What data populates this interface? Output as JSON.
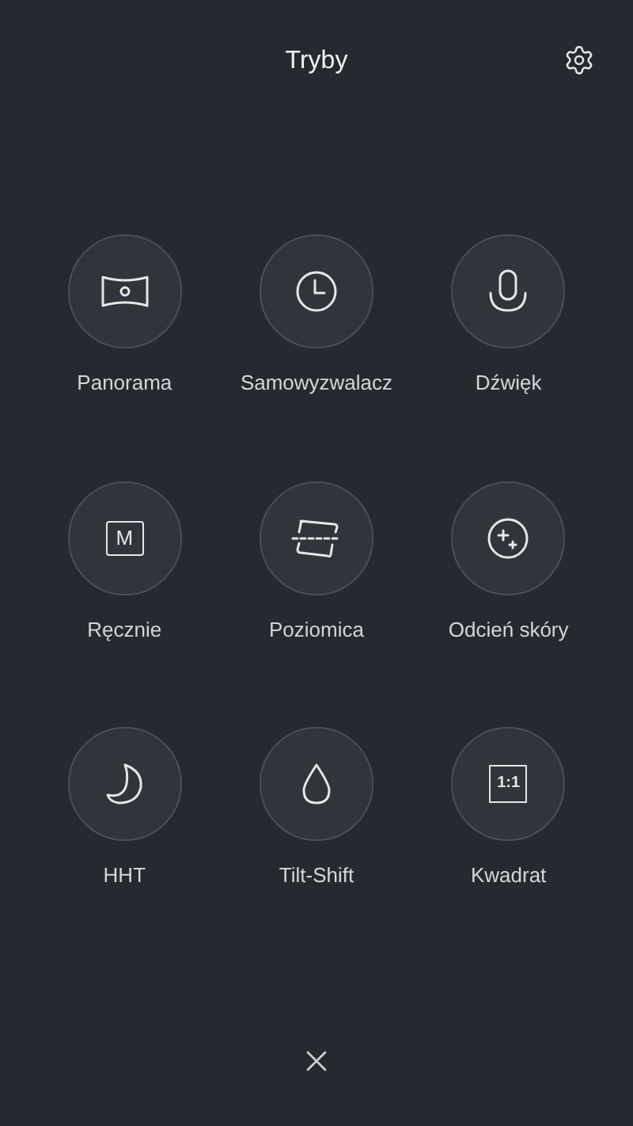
{
  "title": "Tryby",
  "modes": [
    {
      "kind": "panorama",
      "label": "Panorama"
    },
    {
      "kind": "timer",
      "label": "Samowyzwalacz"
    },
    {
      "kind": "audio",
      "label": "Dźwięk"
    },
    {
      "kind": "manual",
      "label": "Ręcznie",
      "icon_text": "M"
    },
    {
      "kind": "level",
      "label": "Poziomica"
    },
    {
      "kind": "beauty",
      "label": "Odcień skóry"
    },
    {
      "kind": "night",
      "label": "HHT"
    },
    {
      "kind": "tiltshift",
      "label": "Tilt-Shift"
    },
    {
      "kind": "square",
      "label": "Kwadrat",
      "icon_text": "1:1"
    }
  ]
}
